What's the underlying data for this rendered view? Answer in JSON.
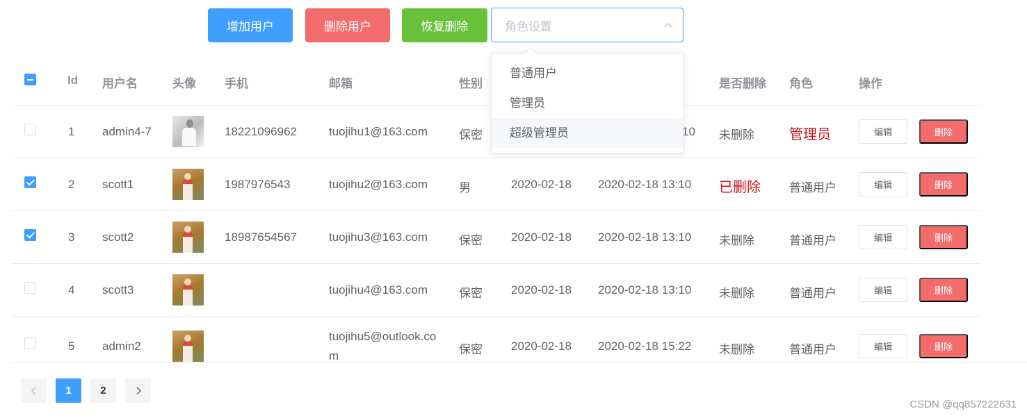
{
  "toolbar": {
    "add_label": "增加用户",
    "delete_label": "删除用户",
    "restore_label": "恢复删除"
  },
  "role_select": {
    "placeholder": "角色设置",
    "options": [
      "普通用户",
      "管理员",
      "超级管理员"
    ],
    "hovered_option": "超级管理员"
  },
  "table": {
    "headers": {
      "id": "Id",
      "username": "用户名",
      "avatar": "头像",
      "phone": "手机",
      "email": "邮箱",
      "gender": "性别",
      "deleted": "是否删除",
      "role": "角色",
      "actions": "操作"
    },
    "edit_label": "编辑",
    "delete_label": "删除",
    "rows": [
      {
        "checked": false,
        "id": "1",
        "username": "admin4-7",
        "phone": "18221096962",
        "email": "tuojihu1@163.com",
        "email2": "",
        "gender": "保密",
        "created": "",
        "updated": "10",
        "deleted": "未删除",
        "role": "管理员"
      },
      {
        "checked": true,
        "id": "2",
        "username": "scott1",
        "phone": "1987976543",
        "email": "tuojihu2@163.com",
        "email2": "",
        "gender": "男",
        "created": "2020-02-18",
        "updated": "2020-02-18 13:10",
        "deleted": "已删除",
        "role": "普通用户"
      },
      {
        "checked": true,
        "id": "3",
        "username": "scott2",
        "phone": "18987654567",
        "email": "tuojihu3@163.com",
        "email2": "",
        "gender": "保密",
        "created": "2020-02-18",
        "updated": "2020-02-18 13:10",
        "deleted": "未删除",
        "role": "普通用户"
      },
      {
        "checked": false,
        "id": "4",
        "username": "scott3",
        "phone": "",
        "email": "tuojihu4@163.com",
        "email2": "",
        "gender": "保密",
        "created": "2020-02-18",
        "updated": "2020-02-18 13:10",
        "deleted": "未删除",
        "role": "普通用户"
      },
      {
        "checked": false,
        "id": "5",
        "username": "admin2",
        "phone": "",
        "email": "tuojihu5@outlook.co",
        "email2": "m",
        "gender": "保密",
        "created": "2020-02-18",
        "updated": "2020-02-18 15:22",
        "deleted": "未删除",
        "role": "普通用户"
      }
    ]
  },
  "pagination": {
    "pages": [
      "1",
      "2"
    ],
    "current": "1"
  },
  "watermark": "CSDN @qq857222631",
  "colors": {
    "primary": "#409eff",
    "danger": "#f56c6c",
    "success": "#67c23a",
    "highlight_red": "#d0101a"
  },
  "icons": {
    "select_arrow": "chevron-up-icon",
    "prev": "chevron-left-icon",
    "next": "chevron-right-icon"
  }
}
